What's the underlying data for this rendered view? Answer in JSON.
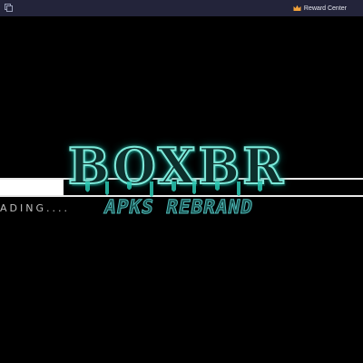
{
  "topbar": {
    "window_icon": "window-icon",
    "reward_icon": "crown-icon",
    "reward_label": "Reward Center",
    "reward_color": "#f2a23a"
  },
  "loading": {
    "text": "ADING....",
    "progress_fraction": 0.17
  },
  "logo": {
    "title": "BOXBR",
    "subtitle": "APKS REBRAND",
    "accent_color": "#2ce0c8"
  }
}
